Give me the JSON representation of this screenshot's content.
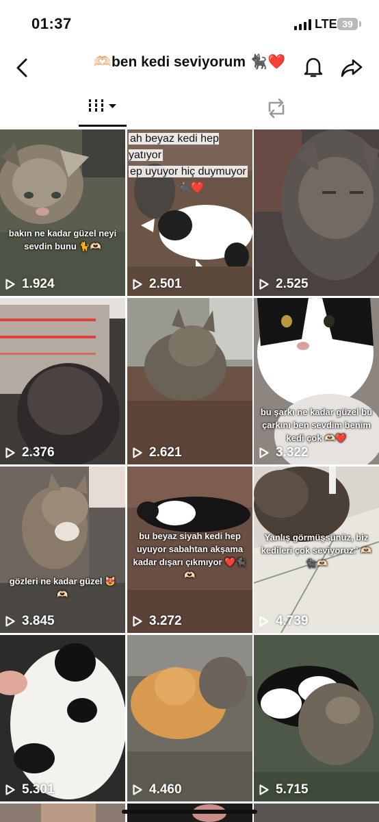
{
  "status": {
    "time": "01:37",
    "network": "LTE",
    "battery": "39"
  },
  "header": {
    "title": "🫶🏻ben kedi seviyorum 🐈‍⬛❤️"
  },
  "colors": {
    "text": "#111111",
    "tab_indicator": "#111111",
    "overlay_text": "#ffffff"
  },
  "icons": {
    "back": "chevron-left-icon",
    "bell": "bell-icon",
    "share": "share-arrow-icon",
    "grid_tab": "grid-columns-icon",
    "repost_tab": "repost-icon",
    "play": "play-icon"
  },
  "grid": {
    "videos": [
      {
        "views": "1.924",
        "caption": "bakın ne kadar güzel neyi sevdin bunu 🐈🫶🏻"
      },
      {
        "views": "2.501",
        "caption_top": [
          "ah beyaz kedi hep yatıyor",
          "ep uyuyor hiç duymuyor",
          "🐈‍⬛❤️"
        ]
      },
      {
        "views": "2.525"
      },
      {
        "views": "2.376"
      },
      {
        "views": "2.621"
      },
      {
        "views": "3.322",
        "caption": "bu şarkı ne kadar güzel bu çarkını ben sevdim benim kedi çok 🫶🏻❤️"
      },
      {
        "views": "3.845",
        "caption": "gözleri ne kadar güzel 😻🫶🏻"
      },
      {
        "views": "3.272",
        "caption": "bu beyaz siyah kedi hep uyuyor sabahtan akşama kadar dışarı çıkmıyor ❤️🐈‍⬛🫶🏻"
      },
      {
        "views": "4.739",
        "caption": "Yanlış görmüşsünüz, biz kedileri çok seviyoruz.' 🫶🏻🐈‍⬛🫶🏻"
      },
      {
        "views": "5.301"
      },
      {
        "views": "4.460"
      },
      {
        "views": "5.715"
      }
    ]
  }
}
